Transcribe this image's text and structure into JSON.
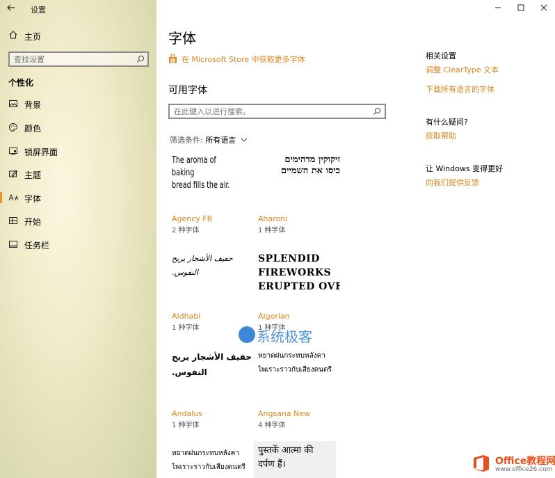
{
  "window": {
    "title": "设置",
    "controls": {
      "minimize": "—",
      "maximize": "☐",
      "close": "✕"
    }
  },
  "sidebar": {
    "home": "主页",
    "search_placeholder": "查找设置",
    "section": "个性化",
    "items": [
      {
        "label": "背景",
        "icon": "picture-icon"
      },
      {
        "label": "颜色",
        "icon": "palette-icon"
      },
      {
        "label": "锁屏界面",
        "icon": "lock-screen-icon"
      },
      {
        "label": "主题",
        "icon": "theme-icon"
      },
      {
        "label": "字体",
        "icon": "font-icon",
        "active": true
      },
      {
        "label": "开始",
        "icon": "start-icon"
      },
      {
        "label": "任务栏",
        "icon": "taskbar-icon"
      }
    ]
  },
  "main": {
    "title": "字体",
    "store_link": "在 Microsoft Store 中获取更多字体",
    "available_title": "可用字体",
    "search_placeholder": "在此键入以进行搜索。",
    "filter_label": "筛选条件:",
    "filter_value": "所有语言",
    "fonts": [
      {
        "preview_lines": [
          "The aroma of baking",
          "bread fills the air."
        ],
        "name": "Agency FB",
        "count": "2 种字体"
      },
      {
        "preview_lines": [
          "זיקוקין מדהימים",
          "כיסו את השמיים"
        ],
        "name": "Aharoni",
        "count": "1 种字体"
      },
      {
        "preview_lines": [
          "حفيف الأشجار يريح النفوس."
        ],
        "name": "Aldhabi",
        "count": "1 种字体"
      },
      {
        "preview_lines": [
          "SPLENDID",
          "FIREWORKS",
          "ERUPTED OVE..."
        ],
        "name": "Algerian",
        "count": "1 种字体"
      },
      {
        "preview_lines": [
          "حفيف الأشجار يريح",
          "النفوس."
        ],
        "name": "Andalus",
        "count": "1 种字体"
      },
      {
        "preview_lines": [
          "หยาดฝนกระทบหลังคา",
          "ไพเราะราวกับเสียงดนตรี"
        ],
        "name": "Angsana New",
        "count": "4 种字体"
      },
      {
        "preview_lines": [
          "หยาดฝนกระทบหลังคา",
          "ไพเราะราวกับเสียงดนตรี"
        ],
        "name": "",
        "count": ""
      },
      {
        "preview_lines": [
          "पुस्तकें आत्मा की",
          "दर्पण हैं।"
        ],
        "name": "",
        "count": ""
      }
    ]
  },
  "right_panel": {
    "related_title": "相关设置",
    "related_links": [
      "调整 ClearType 文本",
      "下载所有语言的字体"
    ],
    "help_title": "有什么疑问?",
    "help_link": "获取帮助",
    "improve_title": "让 Windows 变得更好",
    "improve_link": "向我们提供反馈"
  },
  "watermarks": {
    "center": "系统极客",
    "corner_title": "Office教程网",
    "corner_url": "www.office26.com"
  }
}
